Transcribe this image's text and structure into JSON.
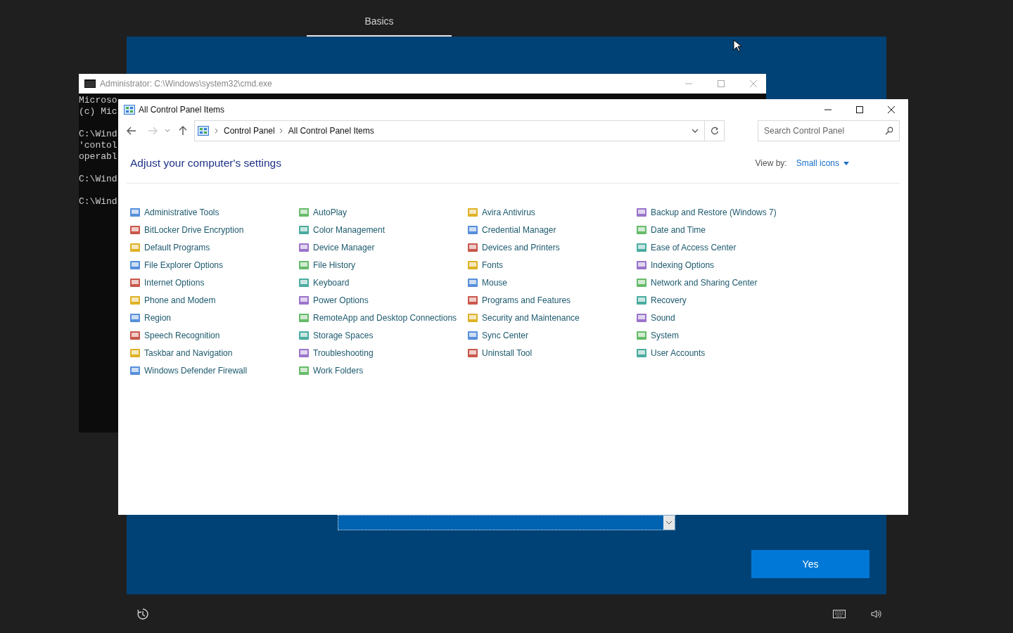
{
  "background_tab": {
    "label": "Basics",
    "selected": true
  },
  "cmd_window": {
    "title": "Administrator: C:\\Windows\\system32\\cmd.exe",
    "blocks": [
      [
        "Microso",
        "(c) Mic"
      ],
      [
        "C:\\Wind",
        "'contol",
        "operabl"
      ],
      [
        "C:\\Wind"
      ],
      [
        "C:\\Wind"
      ]
    ]
  },
  "control_panel": {
    "title": "All Control Panel Items",
    "breadcrumb": [
      "Control Panel",
      "All Control Panel Items"
    ],
    "search": {
      "placeholder": "Search Control Panel"
    },
    "heading": "Adjust your computer's settings",
    "view_by": {
      "label": "View by:",
      "value": "Small icons"
    },
    "items": [
      "Administrative Tools",
      "AutoPlay",
      "Avira Antivirus",
      "Backup and Restore (Windows 7)",
      "BitLocker Drive Encryption",
      "Color Management",
      "Credential Manager",
      "Date and Time",
      "Default Programs",
      "Device Manager",
      "Devices and Printers",
      "Ease of Access Center",
      "File Explorer Options",
      "File History",
      "Fonts",
      "Indexing Options",
      "Internet Options",
      "Keyboard",
      "Mouse",
      "Network and Sharing Center",
      "Phone and Modem",
      "Power Options",
      "Programs and Features",
      "Recovery",
      "Region",
      "RemoteApp and Desktop Connections",
      "Security and Maintenance",
      "Sound",
      "Speech Recognition",
      "Storage Spaces",
      "Sync Center",
      "System",
      "Taskbar and Navigation",
      "Troubleshooting",
      "Uninstall Tool",
      "User Accounts",
      "Windows Defender Firewall",
      "Work Folders"
    ]
  },
  "setup": {
    "button": "Yes"
  }
}
